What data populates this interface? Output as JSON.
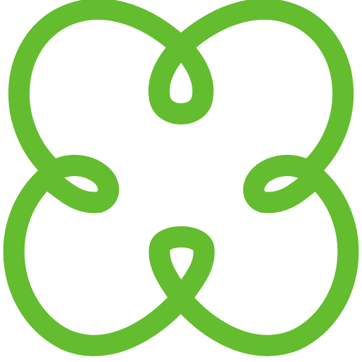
{
  "image": {
    "icon_name": "knot-icon",
    "stroke_color": "#64BC2F",
    "background_color": "#FFFFFF"
  }
}
